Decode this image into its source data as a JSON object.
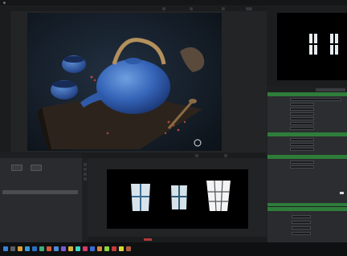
{
  "window": {
    "title": "",
    "right_label": ""
  },
  "viewer": {
    "toolbar_items": [
      "",
      "",
      "",
      ""
    ]
  },
  "properties": {
    "tabs": [
      "",
      "",
      ""
    ],
    "accent_color": "#2e7d3a",
    "sections": [
      {
        "title": ""
      },
      {
        "title": ""
      },
      {
        "title": ""
      }
    ],
    "rows": [
      {
        "label": "",
        "value": ""
      },
      {
        "label": "",
        "value": ""
      },
      {
        "label": "",
        "value": ""
      },
      {
        "label": "",
        "value": ""
      },
      {
        "label": "",
        "value": ""
      },
      {
        "label": "",
        "value": ""
      },
      {
        "label": "",
        "value": ""
      },
      {
        "label": "",
        "value": ""
      },
      {
        "label": "",
        "value": ""
      },
      {
        "label": "",
        "value": ""
      },
      {
        "label": "",
        "value": ""
      },
      {
        "label": "",
        "value": ""
      }
    ]
  },
  "bottom_left": {
    "title": "",
    "list": [
      "",
      ""
    ]
  },
  "bottom_center": {
    "title": "",
    "toolbar_items": [
      "",
      ""
    ]
  },
  "icons": {
    "taskbar": [
      "windows-icon",
      "search-icon",
      "folder-icon",
      "browser-icon",
      "mail-icon",
      "app-icon",
      "app-icon",
      "app-icon",
      "app-icon",
      "app-icon",
      "app-icon",
      "app-icon",
      "app-icon",
      "app-icon",
      "app-icon",
      "app-icon",
      "app-icon",
      "app-icon"
    ]
  }
}
